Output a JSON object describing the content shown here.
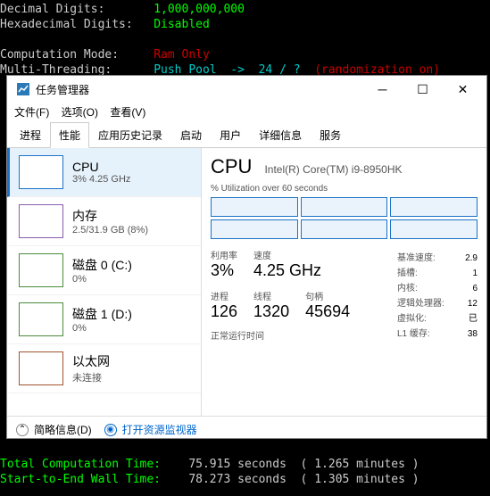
{
  "terminal": {
    "l1a": "Decimal Digits:       ",
    "l1b": "1,000,000,000",
    "l2a": "Hexadecimal Digits:   ",
    "l2b": "Disabled",
    "l4a": "Computation Mode:     ",
    "l4b": "Ram Only",
    "l5a": "Multi-Threading:      ",
    "l5b": "Push Pool  ->  24 / ?  ",
    "l5c": "(randomization on)",
    "b1a": "Total Computation Time:    ",
    "b1b": "75.915 seconds  ( 1.265 minutes )",
    "b2a": "Start-to-End Wall Time:    ",
    "b2b": "78.273 seconds  ( 1.305 minutes )"
  },
  "win": {
    "title": "任务管理器",
    "menu": {
      "file": "文件(F)",
      "options": "选项(O)",
      "view": "查看(V)"
    },
    "tabs": [
      "进程",
      "性能",
      "应用历史记录",
      "启动",
      "用户",
      "详细信息",
      "服务"
    ],
    "sidebar": [
      {
        "name": "CPU",
        "sub": "3% 4.25 GHz",
        "cls": ""
      },
      {
        "name": "内存",
        "sub": "2.5/31.9 GB (8%)",
        "cls": "mem"
      },
      {
        "name": "磁盘 0 (C:)",
        "sub": "0%",
        "cls": "disk"
      },
      {
        "name": "磁盘 1 (D:)",
        "sub": "0%",
        "cls": "disk"
      },
      {
        "name": "以太网",
        "sub": "未连接",
        "cls": "net"
      }
    ],
    "detail": {
      "title": "CPU",
      "model": "Intel(R) Core(TM) i9-8950HK",
      "util_label": "% Utilization over 60 seconds",
      "stats": [
        {
          "lbl": "利用率",
          "val": "3%"
        },
        {
          "lbl": "速度",
          "val": "4.25 GHz"
        }
      ],
      "stats2": [
        {
          "lbl": "进程",
          "val": "126"
        },
        {
          "lbl": "线程",
          "val": "1320"
        },
        {
          "lbl": "句柄",
          "val": "45694"
        }
      ],
      "uptime_lbl": "正常运行时间",
      "right": [
        {
          "k": "基准速度:",
          "v": "2.9"
        },
        {
          "k": "插槽:",
          "v": "1"
        },
        {
          "k": "内核:",
          "v": "6"
        },
        {
          "k": "逻辑处理器:",
          "v": "12"
        },
        {
          "k": "虚拟化:",
          "v": "已"
        },
        {
          "k": "L1 缓存:",
          "v": "38"
        }
      ]
    },
    "footer": {
      "less": "简略信息(D)",
      "monitor": "打开资源监视器"
    }
  }
}
